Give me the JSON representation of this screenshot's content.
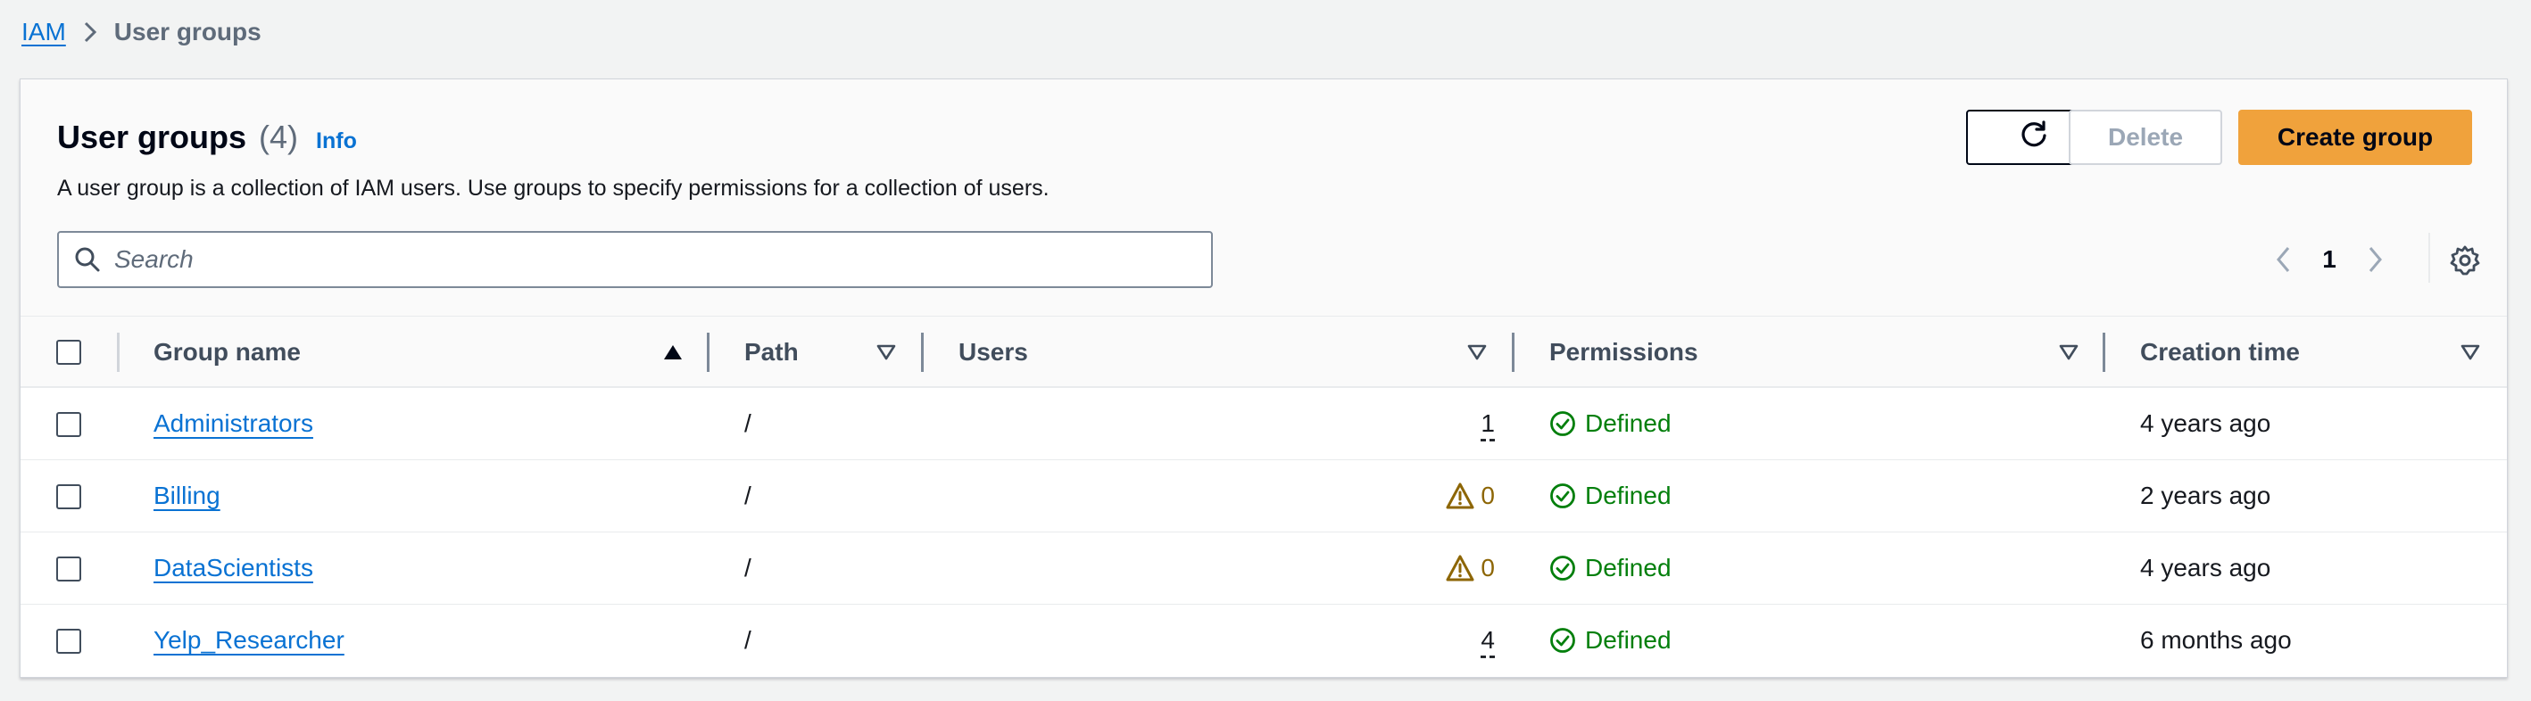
{
  "breadcrumb": {
    "root": "IAM",
    "current": "User groups"
  },
  "header": {
    "title": "User groups",
    "count": "(4)",
    "info": "Info",
    "description": "A user group is a collection of IAM users. Use groups to specify permissions for a collection of users."
  },
  "actions": {
    "delete": "Delete",
    "create": "Create group"
  },
  "search": {
    "placeholder": "Search",
    "value": ""
  },
  "pagination": {
    "current_page": "1"
  },
  "columns": {
    "group_name": "Group name",
    "path": "Path",
    "users": "Users",
    "permissions": "Permissions",
    "creation_time": "Creation time"
  },
  "rows": [
    {
      "name": "Administrators",
      "path": "/",
      "users": "1",
      "users_warning": false,
      "permissions": "Defined",
      "created": "4 years ago"
    },
    {
      "name": "Billing",
      "path": "/",
      "users": "0",
      "users_warning": true,
      "permissions": "Defined",
      "created": "2 years ago"
    },
    {
      "name": "DataScientists",
      "path": "/",
      "users": "0",
      "users_warning": true,
      "permissions": "Defined",
      "created": "4 years ago"
    },
    {
      "name": "Yelp_Researcher",
      "path": "/",
      "users": "4",
      "users_warning": false,
      "permissions": "Defined",
      "created": "6 months ago"
    }
  ],
  "colors": {
    "link": "#0972d3",
    "primary_button": "#f0a23c",
    "success": "#037f0c",
    "warning": "#8d6605"
  },
  "icons": {
    "refresh": "refresh-icon",
    "search": "search-icon",
    "settings": "gear-icon",
    "warning": "warning-icon",
    "success": "check-circle-icon"
  }
}
